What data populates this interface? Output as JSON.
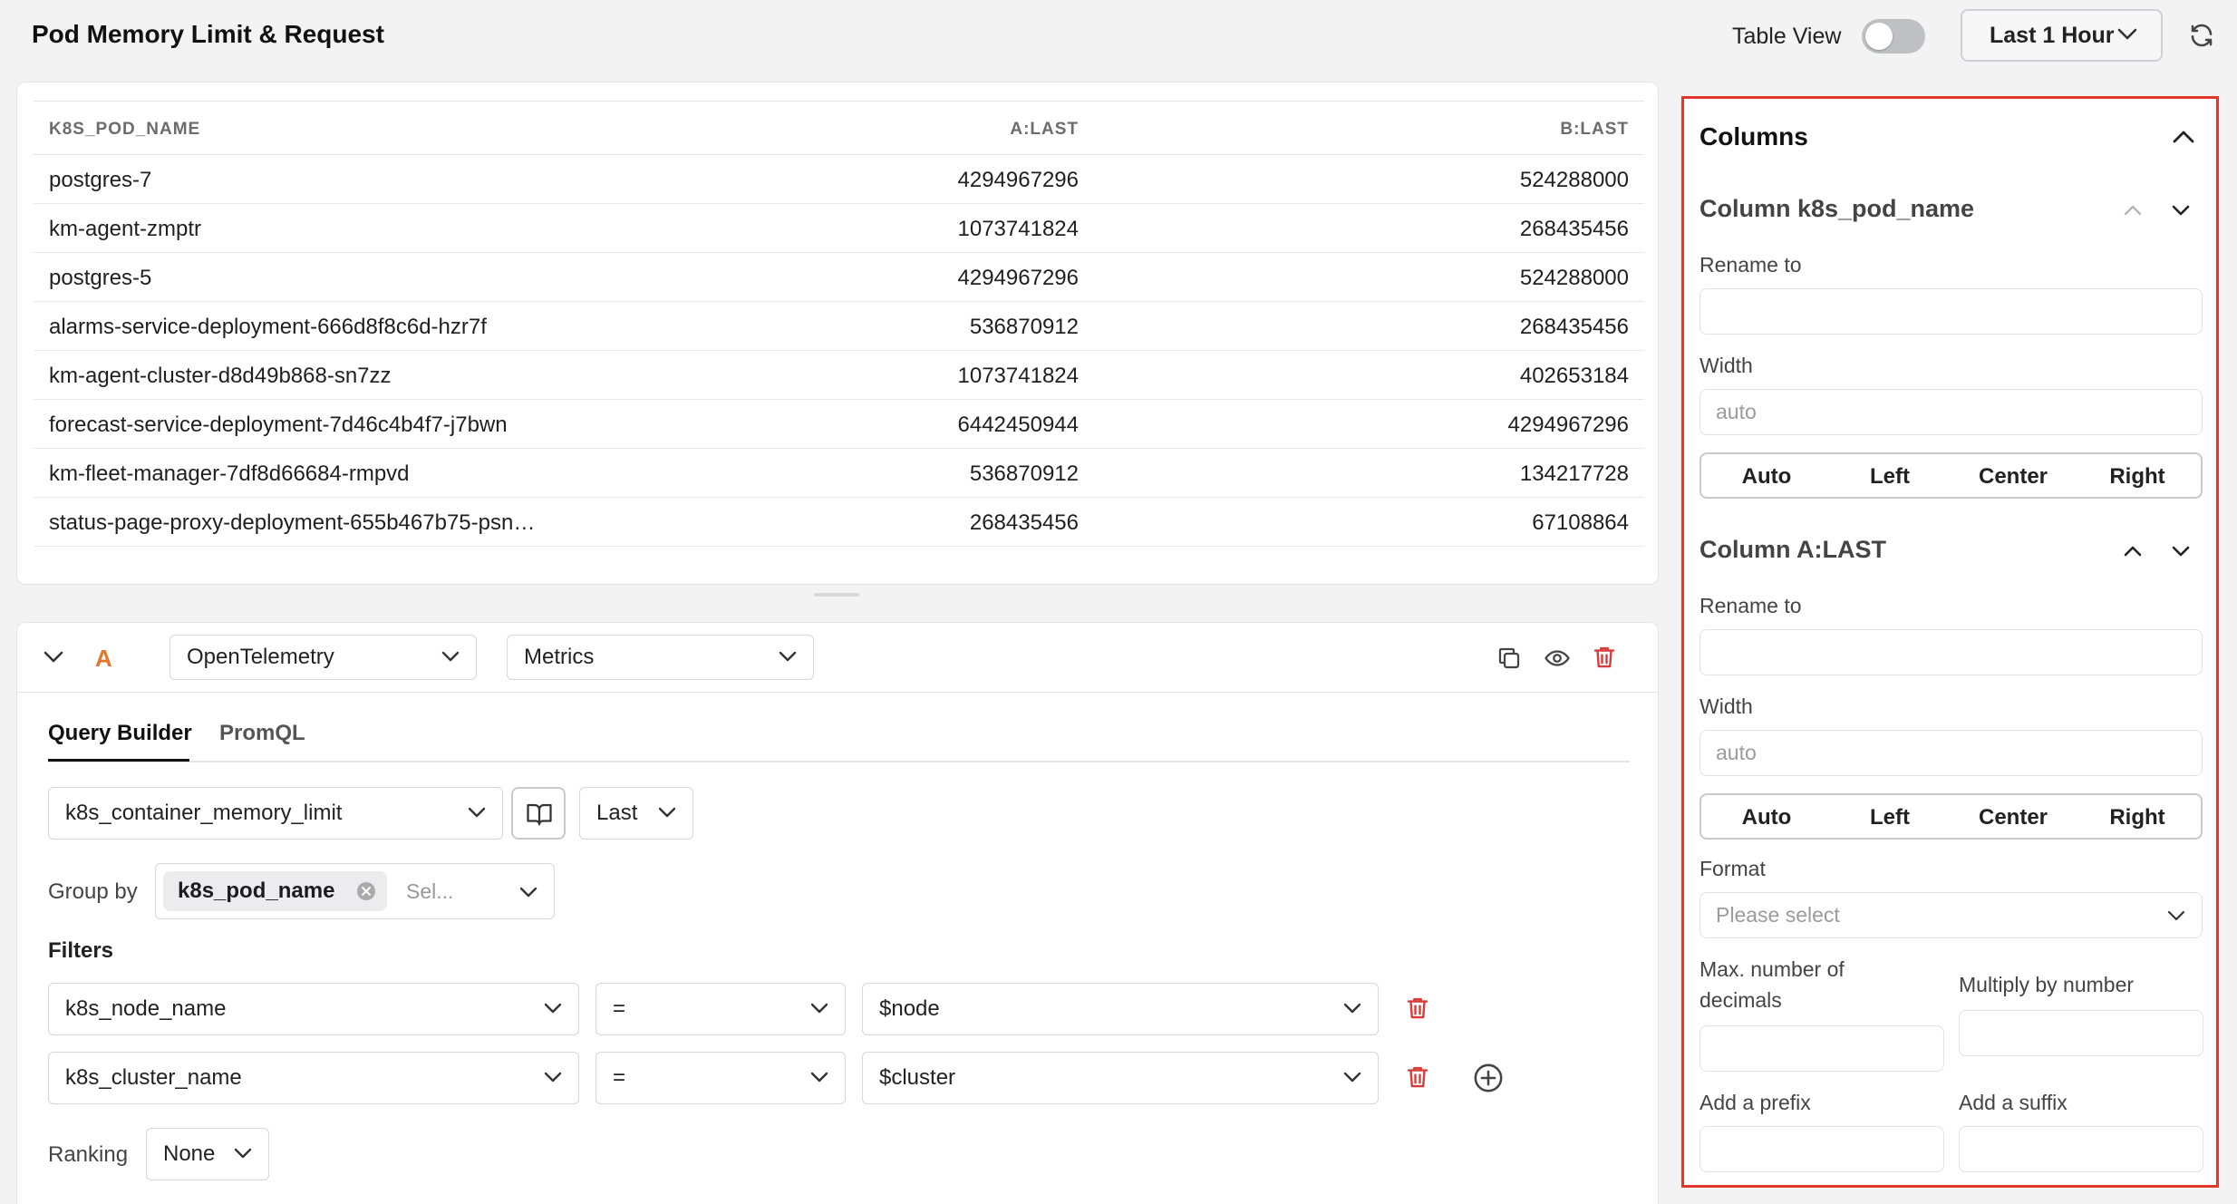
{
  "header": {
    "title": "Pod Memory Limit & Request",
    "table_view_label": "Table View",
    "table_view_on": false,
    "time_range": "Last 1 Hour"
  },
  "table": {
    "columns": [
      "K8S_POD_NAME",
      "A:LAST",
      "B:LAST"
    ],
    "rows": [
      [
        "postgres-7",
        "4294967296",
        "524288000"
      ],
      [
        "km-agent-zmptr",
        "1073741824",
        "268435456"
      ],
      [
        "postgres-5",
        "4294967296",
        "524288000"
      ],
      [
        "alarms-service-deployment-666d8f8c6d-hzr7f",
        "536870912",
        "268435456"
      ],
      [
        "km-agent-cluster-d8d49b868-sn7zz",
        "1073741824",
        "402653184"
      ],
      [
        "forecast-service-deployment-7d46c4b4f7-j7bwn",
        "6442450944",
        "4294967296"
      ],
      [
        "km-fleet-manager-7df8d66684-rmpvd",
        "536870912",
        "134217728"
      ],
      [
        "status-page-proxy-deployment-655b467b75-psn…",
        "268435456",
        "67108864"
      ]
    ]
  },
  "query": {
    "label": "A",
    "source": "OpenTelemetry",
    "type": "Metrics",
    "tabs": [
      "Query Builder",
      "PromQL"
    ],
    "metric": "k8s_container_memory_limit",
    "aggregation": "Last",
    "group_by_label": "Group by",
    "group_by_chip": "k8s_pod_name",
    "group_by_placeholder": "Sel...",
    "filters_label": "Filters",
    "filters": [
      {
        "key": "k8s_node_name",
        "op": "=",
        "value": "$node"
      },
      {
        "key": "k8s_cluster_name",
        "op": "=",
        "value": "$cluster"
      }
    ],
    "ranking_label": "Ranking",
    "ranking_value": "None"
  },
  "panel": {
    "title": "Columns",
    "col1": {
      "title": "Column k8s_pod_name",
      "rename_label": "Rename to",
      "rename_value": "",
      "width_label": "Width",
      "width_placeholder": "auto",
      "align": [
        "Auto",
        "Left",
        "Center",
        "Right"
      ]
    },
    "col2": {
      "title": "Column A:LAST",
      "rename_label": "Rename to",
      "rename_value": "",
      "width_label": "Width",
      "width_placeholder": "auto",
      "align": [
        "Auto",
        "Left",
        "Center",
        "Right"
      ],
      "format_label": "Format",
      "format_placeholder": "Please select",
      "decimals_label_1": "Max. number of",
      "decimals_label_2": "decimals",
      "multiply_label": "Multiply by number",
      "prefix_label": "Add a prefix",
      "suffix_label": "Add a suffix"
    }
  },
  "colors": {
    "accent_orange": "#e5762b",
    "danger_red": "#d93a3a",
    "highlight_border": "#e0382b"
  }
}
